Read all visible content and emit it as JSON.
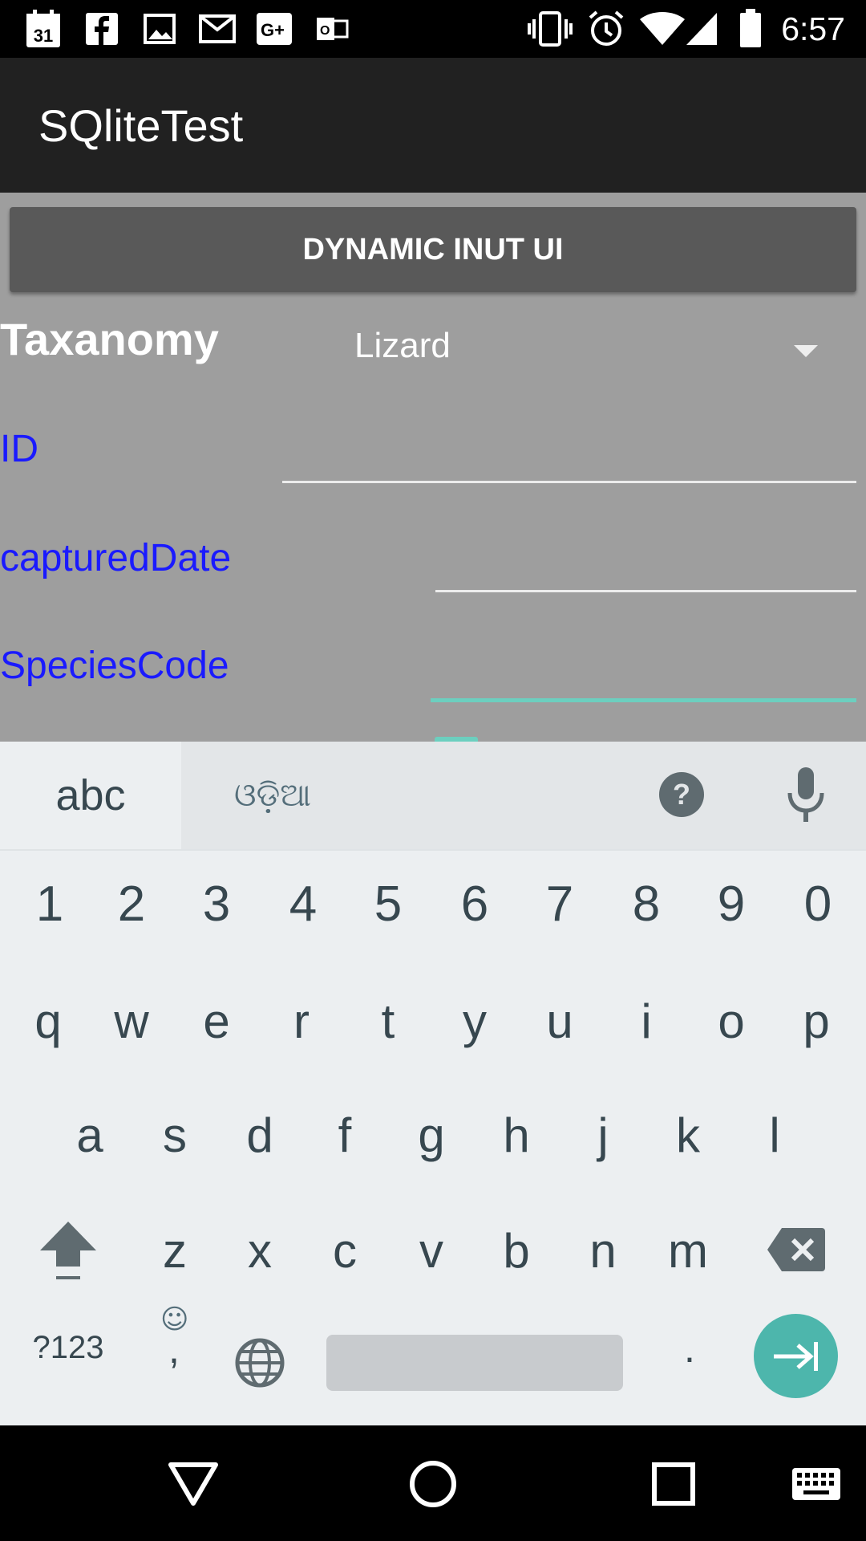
{
  "status_bar": {
    "calendar_day": "31",
    "time": "6:57",
    "icons": [
      "calendar-icon",
      "facebook-icon",
      "gallery-icon",
      "gmail-icon",
      "google-plus-icon",
      "outlook-icon",
      "vibrate-icon",
      "alarm-icon",
      "wifi-icon",
      "signal-icon",
      "battery-icon"
    ]
  },
  "app_bar": {
    "title": "SQliteTest"
  },
  "content": {
    "dynamic_button_label": "DYNAMIC INUT UI",
    "taxonomy": {
      "label": "Taxanomy",
      "selected": "Lizard"
    },
    "fields": [
      {
        "label": "ID",
        "value": ""
      },
      {
        "label": "capturedDate",
        "value": ""
      },
      {
        "label": "SpeciesCode",
        "value": "",
        "focused": true
      }
    ]
  },
  "keyboard": {
    "mode_abc": "abc",
    "mode_script": "ଓଡ଼ିଆ",
    "number_row": [
      "1",
      "2",
      "3",
      "4",
      "5",
      "6",
      "7",
      "8",
      "9",
      "0"
    ],
    "row1": [
      "q",
      "w",
      "e",
      "r",
      "t",
      "y",
      "u",
      "i",
      "o",
      "p"
    ],
    "row2": [
      "a",
      "s",
      "d",
      "f",
      "g",
      "h",
      "j",
      "k",
      "l"
    ],
    "row3": [
      "z",
      "x",
      "c",
      "v",
      "b",
      "n",
      "m"
    ],
    "symbols_label": "?123",
    "comma": ",",
    "period": ".",
    "enter_icon": "tab-next-icon"
  },
  "nav_bar": {
    "icons": [
      "back-icon",
      "home-icon",
      "recents-icon",
      "keyboard-switch-icon"
    ]
  },
  "colors": {
    "accent": "#4db6ac",
    "field_label": "#1a1aff",
    "content_bg": "#9e9e9e",
    "app_bar": "#212121"
  }
}
